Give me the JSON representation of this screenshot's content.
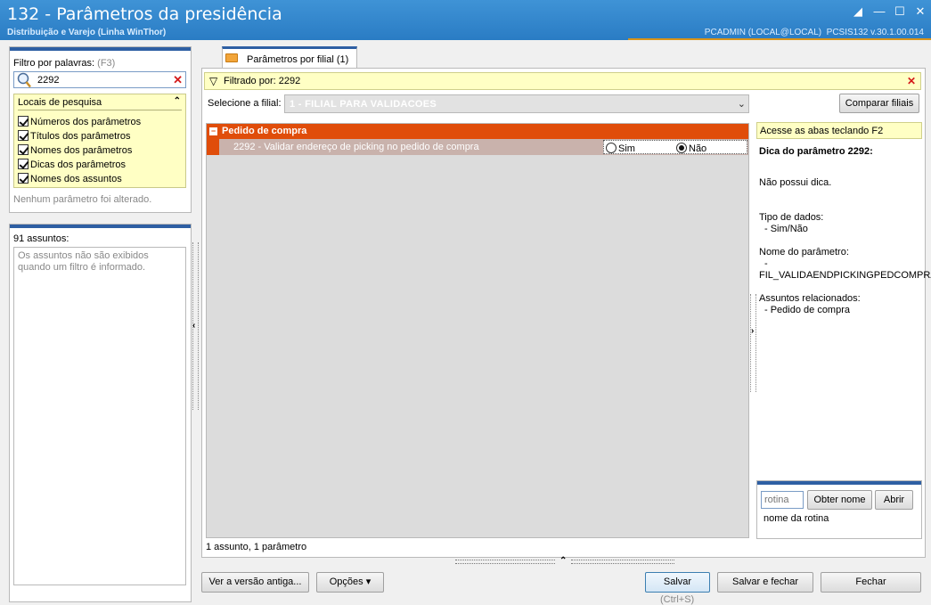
{
  "window": {
    "title": "132 - Parâmetros da presidência",
    "subtitle": "Distribuição e Varejo (Linha WinThor)",
    "user": "PCADMIN (LOCAL@LOCAL)",
    "version": "PCSIS132  v.30.1.00.014"
  },
  "filter": {
    "label": "Filtro por palavras:",
    "shortcut": "(F3)",
    "value": "2292",
    "locais_title": "Locais de pesquisa",
    "options": [
      "Números dos parâmetros",
      "Títulos dos parâmetros",
      "Nomes dos parâmetros",
      "Dicas dos parâmetros",
      "Nomes dos assuntos"
    ],
    "no_change": "Nenhum parâmetro foi alterado."
  },
  "assuntos": {
    "count_label": "91 assuntos:",
    "message": "Os assuntos não são exibidos quando um filtro é informado."
  },
  "tab": {
    "label": "Parâmetros por filial  (1)"
  },
  "filtered": {
    "text": "Filtrado por: 2292"
  },
  "filial": {
    "label": "Selecione a filial:",
    "value": "1 - FILIAL PARA VALIDACOES",
    "compare_button": "Comparar filiais"
  },
  "grid": {
    "group": "Pedido de compra",
    "param": "2292 - Validar endereço de picking no pedido de compra",
    "option_yes": "Sim",
    "option_no": "Não",
    "selected": "Não"
  },
  "status": {
    "text": "1 assunto, 1 parâmetro"
  },
  "hint": {
    "tab_tip": "Acesse as abas teclando F2",
    "title": "Dica do parâmetro 2292:",
    "no_tip": "Não possui dica.",
    "data_type_label": "Tipo de dados:",
    "data_type_value": "- Sim/Não",
    "param_name_label": "Nome do parâmetro:",
    "param_name_dash": "-",
    "param_name_value": "FIL_VALIDAENDPICKINGPEDCOMPRA",
    "related_label": "Assuntos relacionados:",
    "related_value": "- Pedido de compra"
  },
  "routine": {
    "placeholder": "rotina",
    "get_name_button": "Obter nome",
    "open_button": "Abrir",
    "name_label": "nome da rotina"
  },
  "footer": {
    "old_version_button": "Ver a versão antiga...",
    "options_button": "Opções",
    "save_button": "Salvar",
    "save_shortcut": "(Ctrl+S)",
    "save_close_button": "Salvar e fechar",
    "close_button": "Fechar"
  },
  "colors": {
    "titlebar": "#2a7cc4",
    "accent_blue": "#2e5fa3",
    "group_orange": "#e04d0a",
    "hint_yellow": "#ffffc4"
  }
}
